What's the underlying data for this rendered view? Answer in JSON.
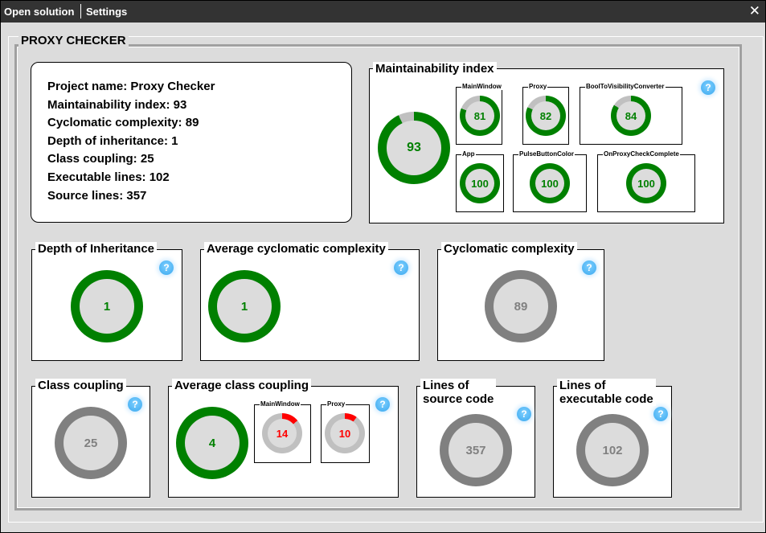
{
  "menu": {
    "open_solution": "Open solution",
    "settings": "Settings",
    "close_glyph": "✕"
  },
  "frame_title": "PROXY CHECKER",
  "info": {
    "project_name": "Project name: Proxy Checker",
    "maintainability": "Maintainability index: 93",
    "cyclomatic": "Cyclomatic complexity: 89",
    "depth": "Depth of inheritance: 1",
    "coupling": "Class coupling: 25",
    "executable": "Executable lines: 102",
    "source": "Source lines: 357"
  },
  "help_glyph": "?",
  "maintainability": {
    "title": "Maintainability index",
    "main": {
      "value": "93",
      "percent": 93
    },
    "classes": [
      {
        "name": "MainWindow",
        "value": "81",
        "percent": 81
      },
      {
        "name": "Proxy",
        "value": "82",
        "percent": 82
      },
      {
        "name": "BoolToVisibilityConverter",
        "value": "84",
        "percent": 84
      },
      {
        "name": "App",
        "value": "100",
        "percent": 100
      },
      {
        "name": "PulseButtonColor",
        "value": "100",
        "percent": 100
      },
      {
        "name": "OnProxyCheckComplete",
        "value": "100",
        "percent": 100
      }
    ]
  },
  "depth_of_inheritance": {
    "title": "Depth of Inheritance",
    "value": "1",
    "percent": 100
  },
  "avg_cyclomatic": {
    "title": "Average cyclomatic complexity",
    "value": "1",
    "percent": 100
  },
  "cyclomatic": {
    "title": "Cyclomatic complexity",
    "value": "89",
    "percent": 100
  },
  "class_coupling": {
    "title": "Class coupling",
    "value": "25",
    "percent": 100
  },
  "avg_class_coupling": {
    "title": "Average class coupling",
    "main": {
      "value": "4",
      "percent": 100
    },
    "classes": [
      {
        "name": "MainWindow",
        "value": "14",
        "percent": 14
      },
      {
        "name": "Proxy",
        "value": "10",
        "percent": 10
      }
    ]
  },
  "source_lines": {
    "title_line1": "Lines of",
    "title_line2": "source code",
    "value": "357",
    "percent": 100
  },
  "executable_lines": {
    "title_line1": "Lines of",
    "title_line2": "executable code",
    "value": "102",
    "percent": 100
  },
  "colors": {
    "good": "#008000",
    "neutral": "#808080",
    "bad": "#ff0000",
    "track": "#c0c0c0",
    "inner": "#dcdcdc"
  }
}
